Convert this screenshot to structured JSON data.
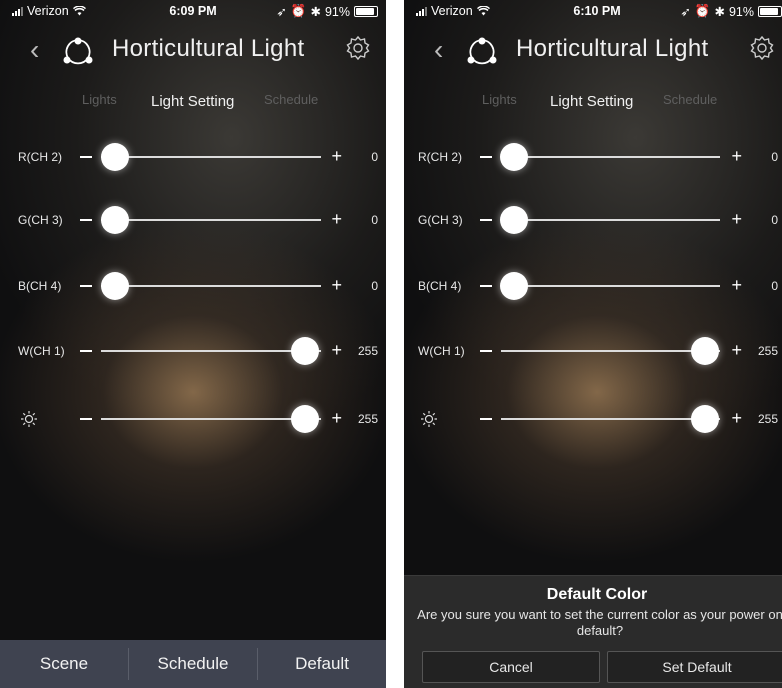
{
  "screens": [
    {
      "status": {
        "carrier": "Verizon",
        "time": "6:09 PM",
        "battery": "91%"
      },
      "nav": {
        "title": "Horticultural Light",
        "back_icon": "chevron-left-icon",
        "settings_icon": "gear-icon"
      },
      "tabs": [
        {
          "label": "Lights"
        },
        {
          "label": "Light Setting",
          "active": true
        },
        {
          "label": "Schedule"
        }
      ],
      "sliders": [
        {
          "label": "R(CH 2)",
          "value": "0"
        },
        {
          "label": "G(CH 3)",
          "value": "0"
        },
        {
          "label": "B(CH 4)",
          "value": "0"
        },
        {
          "label": "W(CH 1)",
          "value": "255"
        },
        {
          "label": "",
          "icon": "sun-icon",
          "value": "255"
        }
      ],
      "plus_symbol": "+",
      "bottom": {
        "scene": "Scene",
        "schedule": "Schedule",
        "default": "Default"
      }
    },
    {
      "status": {
        "carrier": "Verizon",
        "time": "6:10 PM",
        "battery": "91%"
      },
      "nav": {
        "title": "Horticultural Light",
        "back_icon": "chevron-left-icon",
        "settings_icon": "gear-icon"
      },
      "tabs": [
        {
          "label": "Lights"
        },
        {
          "label": "Light Setting",
          "active": true
        },
        {
          "label": "Schedule"
        }
      ],
      "sliders": [
        {
          "label": "R(CH 2)",
          "value": "0"
        },
        {
          "label": "G(CH 3)",
          "value": "0"
        },
        {
          "label": "B(CH 4)",
          "value": "0"
        },
        {
          "label": "W(CH 1)",
          "value": "255"
        },
        {
          "label": "",
          "icon": "sun-icon",
          "value": "255"
        }
      ],
      "plus_symbol": "+",
      "dialog": {
        "title": "Default Color",
        "message": "Are you sure you want to set the current color as your power on default?",
        "cancel": "Cancel",
        "confirm": "Set Default"
      }
    }
  ],
  "colors": {
    "bottom_bar": "#3f4350",
    "dialog_bg": "#2b2b2b",
    "inactive_tab": "#5f5f5f"
  }
}
